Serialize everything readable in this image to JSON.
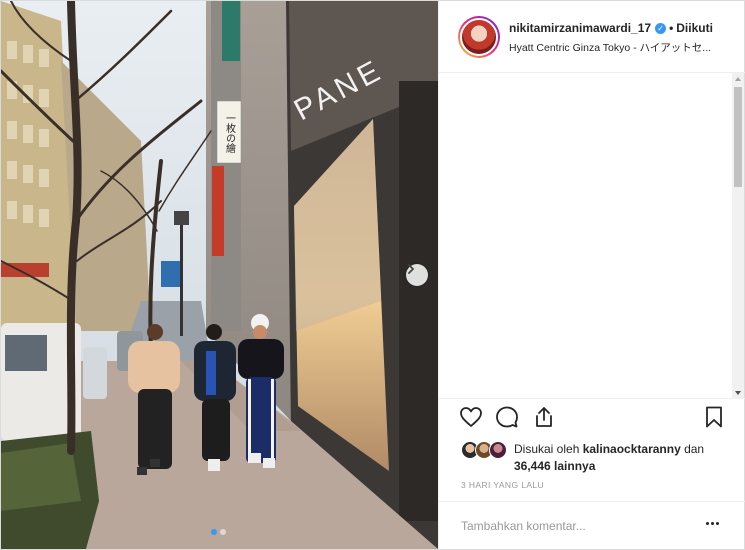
{
  "post": {
    "username": "nikitamirzanimawardi_17",
    "verified_icon": "verified-badge-icon",
    "separator": "•",
    "follow_label": "Diikuti",
    "location": "Hyatt Centric Ginza Tokyo - ハイアットセ..."
  },
  "photo": {
    "store_sign": "PANE",
    "sign_text": "一枚の繪",
    "carousel_total": 2,
    "carousel_active": 1,
    "next_icon": "chevron-right-icon"
  },
  "actions": {
    "like_icon": "heart-icon",
    "comment_icon": "comment-bubble-icon",
    "share_icon": "share-icon",
    "save_icon": "bookmark-icon"
  },
  "likes": {
    "prefix": "Disukai oleh ",
    "liker": "kalinaocktaranny",
    "mid": " dan",
    "count": "36,446",
    "suffix": " lainnya"
  },
  "timestamp": "3 HARI YANG LALU",
  "comment": {
    "placeholder": "Tambahkan komentar...",
    "more_icon": "more-options-icon"
  },
  "colors": {
    "accent": "#3897f0",
    "text": "#262626",
    "muted": "#999999"
  }
}
